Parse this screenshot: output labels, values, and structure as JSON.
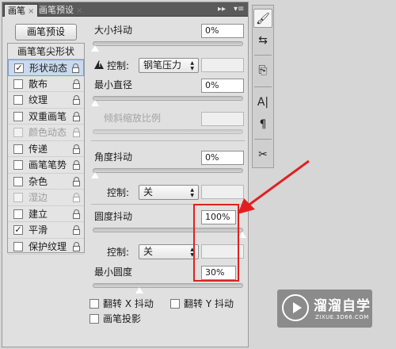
{
  "tabs": [
    {
      "label": "画笔",
      "active": true
    },
    {
      "label": "画笔预设",
      "active": false
    }
  ],
  "tab_controls": {
    "collapse": "▸▸",
    "menu": "▾≡"
  },
  "preset_button": "画笔预设",
  "sidebar": {
    "header": "画笔笔尖形状",
    "items": [
      {
        "label": "形状动态",
        "checked": true,
        "selected": true,
        "enabled": true
      },
      {
        "label": "散布",
        "checked": false,
        "selected": false,
        "enabled": true
      },
      {
        "label": "纹理",
        "checked": false,
        "selected": false,
        "enabled": true
      },
      {
        "label": "双重画笔",
        "checked": false,
        "selected": false,
        "enabled": true
      },
      {
        "label": "颜色动态",
        "checked": false,
        "selected": false,
        "enabled": false
      },
      {
        "label": "传递",
        "checked": false,
        "selected": false,
        "enabled": true
      },
      {
        "label": "画笔笔势",
        "checked": false,
        "selected": false,
        "enabled": true
      },
      {
        "label": "杂色",
        "checked": false,
        "selected": false,
        "enabled": true
      },
      {
        "label": "湿边",
        "checked": false,
        "selected": false,
        "enabled": false
      },
      {
        "label": "建立",
        "checked": false,
        "selected": false,
        "enabled": true
      },
      {
        "label": "平滑",
        "checked": true,
        "selected": false,
        "enabled": true
      },
      {
        "label": "保护纹理",
        "checked": false,
        "selected": false,
        "enabled": true
      }
    ]
  },
  "size_jitter": {
    "label": "大小抖动",
    "value": "0%",
    "level": 0
  },
  "size_control": {
    "label": "控制:",
    "selected": "钢笔压力",
    "value": ""
  },
  "min_diameter": {
    "label": "最小直径",
    "value": "0%",
    "level": 0
  },
  "tilt_scale": {
    "label": "倾斜缩放比例",
    "value": "",
    "enabled": false
  },
  "angle_jitter": {
    "label": "角度抖动",
    "value": "0%",
    "level": 0
  },
  "angle_control": {
    "label": "控制:",
    "selected": "关",
    "value": ""
  },
  "roundness_jitter": {
    "label": "圆度抖动",
    "value": "100%",
    "level": 100
  },
  "roundness_control": {
    "label": "控制:",
    "selected": "关",
    "value": ""
  },
  "min_roundness": {
    "label": "最小圆度",
    "value": "30%",
    "level": 30
  },
  "options": {
    "flip_x": {
      "label": "翻转 X 抖动",
      "checked": false
    },
    "flip_y": {
      "label": "翻转 Y 抖动",
      "checked": false
    },
    "brush_projection": {
      "label": "画笔投影",
      "checked": false
    }
  },
  "tools": [
    {
      "icon": "brush-icon",
      "glyph": "🖌",
      "active": true
    },
    {
      "icon": "brush-settings-icon",
      "glyph": "⇆",
      "active": false
    },
    {
      "icon": "clone-source-icon",
      "glyph": "⎘",
      "active": false
    },
    {
      "icon": "character-icon",
      "glyph": "A|",
      "active": false
    },
    {
      "icon": "paragraph-icon",
      "glyph": "¶",
      "active": false
    },
    {
      "icon": "tools-icon",
      "glyph": "✂",
      "active": false
    }
  ],
  "watermark": {
    "title": "溜溜自学",
    "url": "ZIXUE.3D66.COM"
  },
  "colors": {
    "highlight": "#e02020",
    "selection": "#c9d9ef"
  }
}
